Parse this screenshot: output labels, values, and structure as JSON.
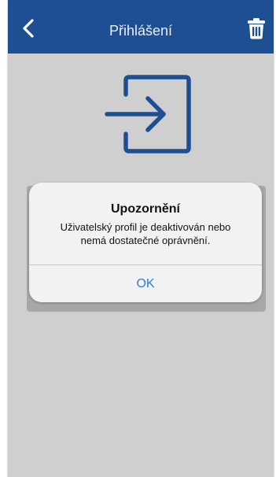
{
  "header": {
    "title": "Přihlášení",
    "back_icon": "chevron-left-icon",
    "trash_icon": "trash-icon",
    "bar_color": "#1f4f93"
  },
  "content": {
    "login_icon": "login-icon",
    "icon_color": "#1f4f93"
  },
  "alert": {
    "title": "Upozornění",
    "message_line_1": "Uživatelský profil je deaktivován nebo",
    "message_line_2": "nemá dostatečné oprávnění.",
    "ok_label": "OK",
    "ok_color": "#2c7de1"
  }
}
